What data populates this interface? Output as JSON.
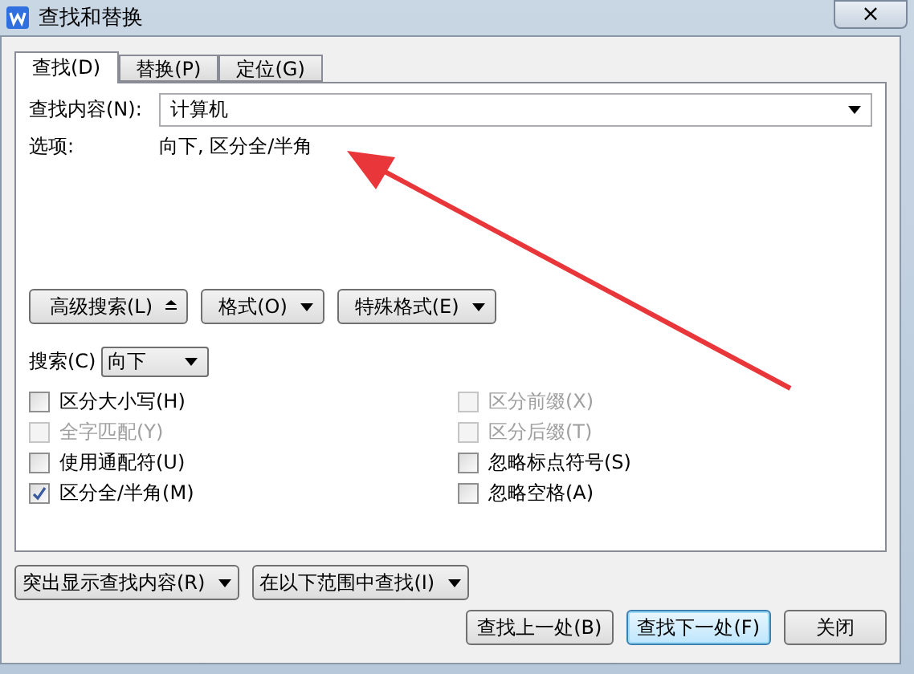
{
  "window": {
    "title": "查找和替换",
    "close": "×"
  },
  "tabs": [
    {
      "label": "查找(D)",
      "selected": true
    },
    {
      "label": "替换(P)",
      "selected": false
    },
    {
      "label": "定位(G)",
      "selected": false
    }
  ],
  "find_field": {
    "label": "查找内容(N):",
    "value": "计算机"
  },
  "options": {
    "label": "选项:",
    "value": "向下, 区分全/半角"
  },
  "tool_buttons": [
    {
      "label": "高级搜索(L)",
      "kind": "expand"
    },
    {
      "label": "格式(O)",
      "kind": "menu"
    },
    {
      "label": "特殊格式(E)",
      "kind": "menu"
    }
  ],
  "search": {
    "label": "搜索(C)",
    "value": "向下"
  },
  "checkboxes_left": [
    {
      "label": "区分大小写(H)",
      "checked": false,
      "disabled": false
    },
    {
      "label": "全字匹配(Y)",
      "checked": false,
      "disabled": true
    },
    {
      "label": "使用通配符(U)",
      "checked": false,
      "disabled": false
    },
    {
      "label": "区分全/半角(M)",
      "checked": true,
      "disabled": false
    }
  ],
  "checkboxes_right": [
    {
      "label": "区分前缀(X)",
      "checked": false,
      "disabled": true
    },
    {
      "label": "区分后缀(T)",
      "checked": false,
      "disabled": true
    },
    {
      "label": "忽略标点符号(S)",
      "checked": false,
      "disabled": false
    },
    {
      "label": "忽略空格(A)",
      "checked": false,
      "disabled": false
    }
  ],
  "range_menus": [
    "突出显示查找内容(R)",
    "在以下范围中查找(I)"
  ],
  "actions": [
    {
      "label": "查找上一处(B)",
      "focused": false
    },
    {
      "label": "查找下一处(F)",
      "focused": true
    },
    {
      "label": "关闭",
      "focused": false
    }
  ]
}
